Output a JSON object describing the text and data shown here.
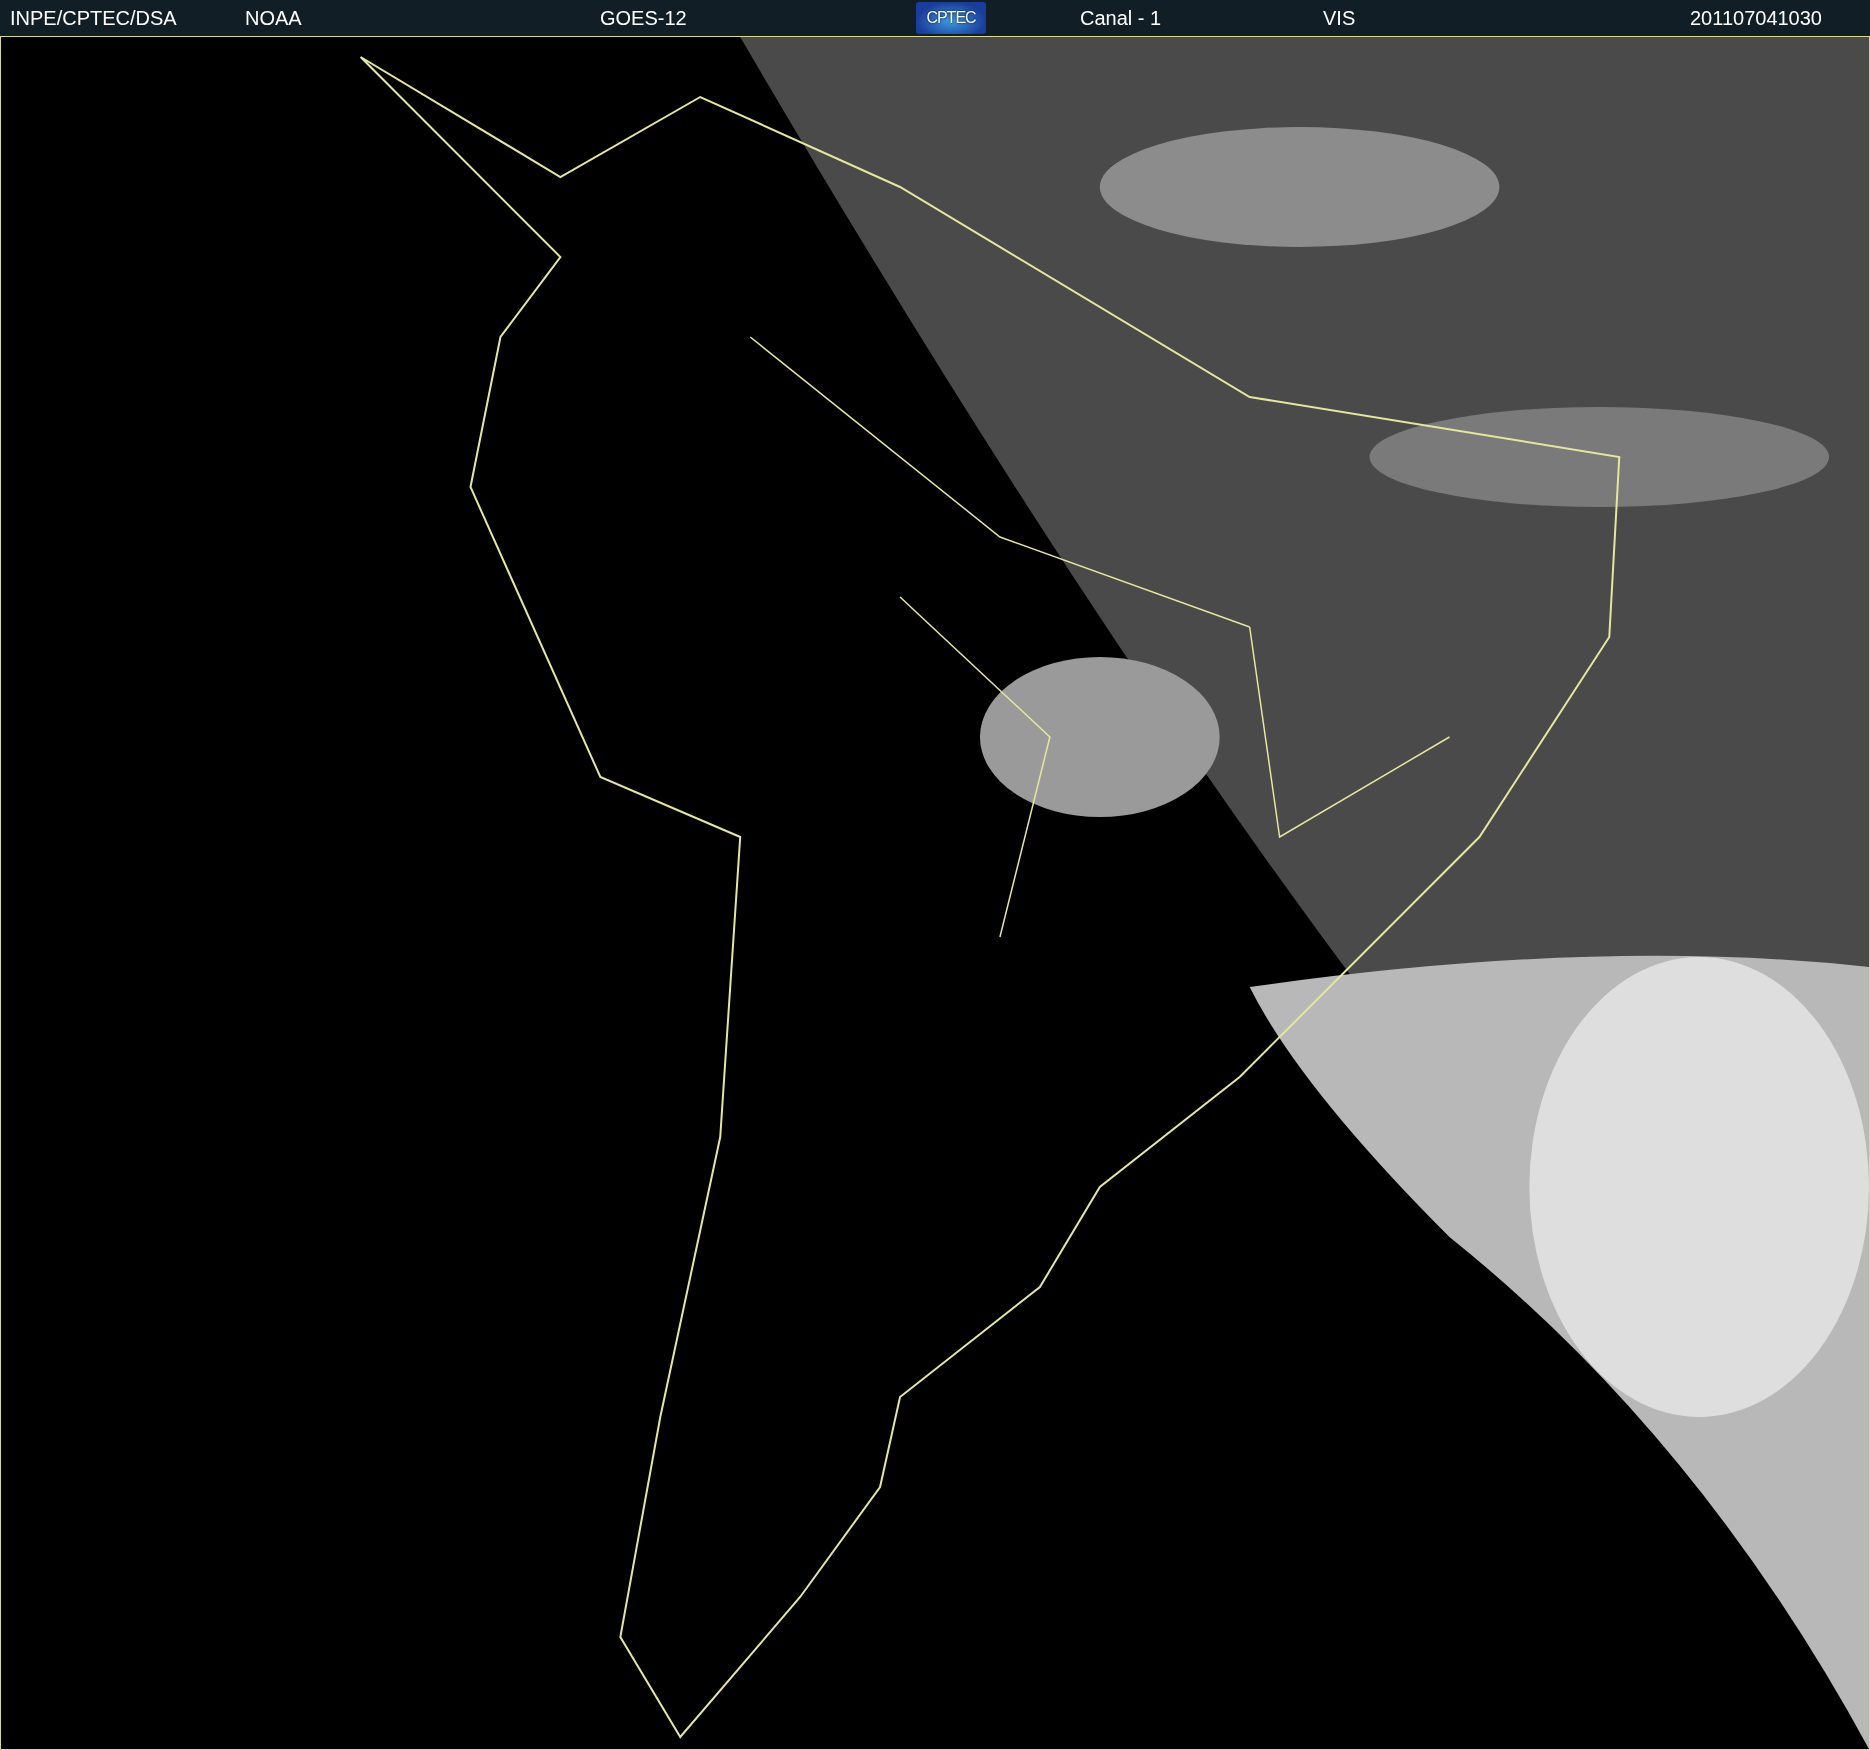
{
  "header": {
    "items": [
      {
        "kind": "text",
        "text": "INPE/CPTEC/DSA"
      },
      {
        "kind": "text",
        "text": "NOAA"
      },
      {
        "kind": "text",
        "text": "GOES-12"
      },
      {
        "kind": "logo",
        "text": "CPTEC"
      },
      {
        "kind": "text",
        "text": "Canal - 1"
      },
      {
        "kind": "text",
        "text": "VIS"
      },
      {
        "kind": "text",
        "text": "201107041030"
      }
    ]
  }
}
